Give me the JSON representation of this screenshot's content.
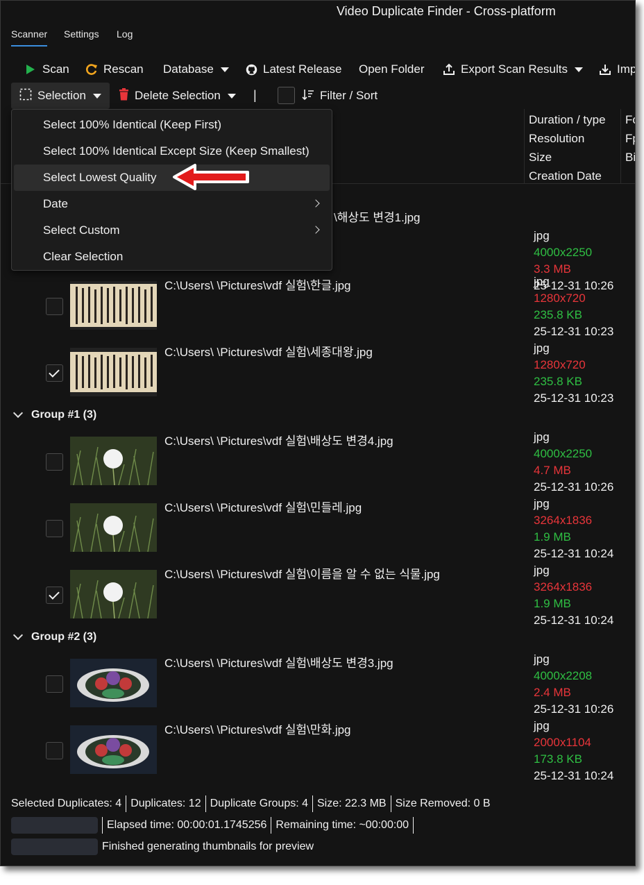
{
  "window": {
    "title": "Video Duplicate Finder - Cross-platform"
  },
  "tabs": [
    {
      "label": "Scanner",
      "active": true
    },
    {
      "label": "Settings",
      "active": false
    },
    {
      "label": "Log",
      "active": false
    }
  ],
  "toolbar": {
    "scan": "Scan",
    "rescan": "Rescan",
    "database": "Database",
    "latest_release": "Latest Release",
    "open_folder": "Open Folder",
    "export": "Export Scan Results",
    "import": "Imp"
  },
  "toolbar2": {
    "selection": "Selection",
    "delete_selection": "Delete Selection",
    "separator": "|",
    "filter_sort": "Filter / Sort"
  },
  "columns": {
    "col1": [
      "Duration / type",
      "Resolution",
      "Size",
      "Creation Date"
    ],
    "col2": [
      "Fo",
      "Fp",
      "Bi"
    ]
  },
  "selection_menu": {
    "items": [
      {
        "label": "Select 100% Identical (Keep First)",
        "submenu": false
      },
      {
        "label": "Select 100% Identical Except Size (Keep Smallest)",
        "submenu": false
      },
      {
        "label": "Select Lowest Quality",
        "submenu": false,
        "highlighted": true
      },
      {
        "label": "Date",
        "submenu": true
      },
      {
        "label": "Select Custom",
        "submenu": true
      },
      {
        "label": "Clear Selection",
        "submenu": false
      }
    ]
  },
  "group0": {
    "rows": [
      {
        "path": "\\해상도 변경1.jpg",
        "type": "jpg",
        "res": "4000x2250",
        "res_color": "green",
        "size": "3.3 MB",
        "size_color": "red",
        "date": "25-12-31 10:26",
        "checked": false
      },
      {
        "path": "C:\\Users\\        \\Pictures\\vdf 실험\\한글.jpg",
        "type": "jpg",
        "res": "1280x720",
        "res_color": "red",
        "size": "235.8 KB",
        "size_color": "green",
        "date": "25-12-31 10:23",
        "checked": false
      },
      {
        "path": "C:\\Users\\        \\Pictures\\vdf 실험\\세종대왕.jpg",
        "type": "jpg",
        "res": "1280x720",
        "res_color": "red",
        "size": "235.8 KB",
        "size_color": "green",
        "date": "25-12-31 10:23",
        "checked": true
      }
    ]
  },
  "group1": {
    "title": "Group #1 (3)",
    "rows": [
      {
        "path": "C:\\Users\\        \\Pictures\\vdf 실험\\배상도 변경4.jpg",
        "type": "jpg",
        "res": "4000x2250",
        "res_color": "green",
        "size": "4.7 MB",
        "size_color": "red",
        "date": "25-12-31 10:26",
        "checked": false
      },
      {
        "path": "C:\\Users\\        \\Pictures\\vdf 실험\\민들레.jpg",
        "type": "jpg",
        "res": "3264x1836",
        "res_color": "red",
        "size": "1.9 MB",
        "size_color": "green",
        "date": "25-12-31 10:24",
        "checked": false
      },
      {
        "path": "C:\\Users\\        \\Pictures\\vdf 실험\\이름을 알 수 없는 식물.jpg",
        "type": "jpg",
        "res": "3264x1836",
        "res_color": "red",
        "size": "1.9 MB",
        "size_color": "green",
        "date": "25-12-31 10:24",
        "checked": true
      }
    ]
  },
  "group2": {
    "title": "Group #2 (3)",
    "rows": [
      {
        "path": "C:\\Users\\        \\Pictures\\vdf 실험\\배상도 변경3.jpg",
        "type": "jpg",
        "res": "4000x2208",
        "res_color": "green",
        "size": "2.4 MB",
        "size_color": "red",
        "date": "25-12-31 10:26",
        "checked": false
      },
      {
        "path": "C:\\Users\\        \\Pictures\\vdf 실험\\만화.jpg",
        "type": "jpg",
        "res": "2000x1104",
        "res_color": "red",
        "size": "173.8 KB",
        "size_color": "green",
        "date": "25-12-31 10:24",
        "checked": false
      }
    ]
  },
  "status": {
    "selected": "Selected Duplicates: 4",
    "duplicates": "Duplicates: 12",
    "groups": "Duplicate Groups: 4",
    "size": "Size: 22.3 MB",
    "removed": "Size Removed: 0 B",
    "elapsed": "Elapsed time: 00:00:01.1745256",
    "remaining": "Remaining time: ~00:00:00",
    "message": "Finished generating thumbnails for preview"
  },
  "colors": {
    "accent": "#3b8ede",
    "green": "#2fbf43",
    "red": "#e8353a",
    "scan_green": "#23b14d",
    "rescan_orange": "#f2a51e",
    "delete_red": "#e8353a"
  }
}
